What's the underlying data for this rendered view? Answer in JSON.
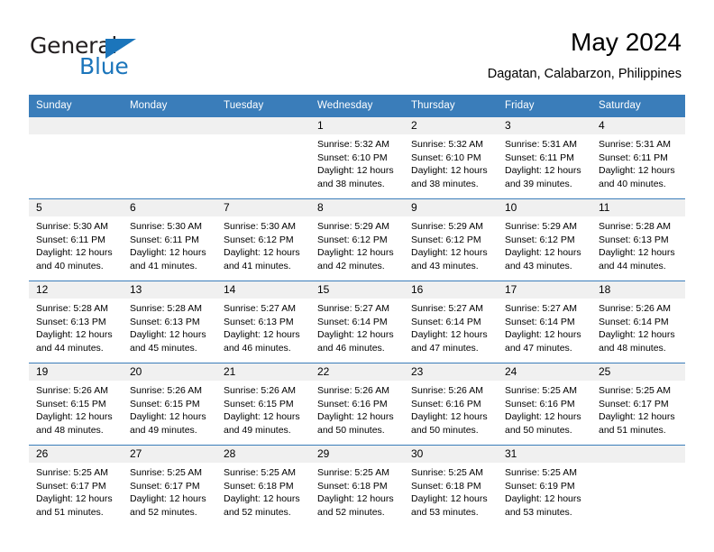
{
  "brand": {
    "name_part1": "General",
    "name_part2": "Blue",
    "triangle_icon": "triangle-icon",
    "color_dark": "#231f20",
    "color_blue": "#1b75bb"
  },
  "header": {
    "title": "May 2024",
    "subtitle": "Dagatan, Calabarzon, Philippines"
  },
  "theme": {
    "header_row_bg": "#3a7dba",
    "daynum_band_bg": "#f0f0f0",
    "row_divider": "#3a7dba",
    "text": "#000000"
  },
  "weekdays": [
    "Sunday",
    "Monday",
    "Tuesday",
    "Wednesday",
    "Thursday",
    "Friday",
    "Saturday"
  ],
  "labels": {
    "sunrise_prefix": "Sunrise:",
    "sunset_prefix": "Sunset:",
    "daylight_prefix": "Daylight:"
  },
  "weeks": [
    [
      {
        "day": "",
        "line1": "",
        "line2": "",
        "line3": "",
        "line4": "",
        "empty": true
      },
      {
        "day": "",
        "line1": "",
        "line2": "",
        "line3": "",
        "line4": "",
        "empty": true
      },
      {
        "day": "",
        "line1": "",
        "line2": "",
        "line3": "",
        "line4": "",
        "empty": true
      },
      {
        "day": "1",
        "line1": "Sunrise: 5:32 AM",
        "line2": "Sunset: 6:10 PM",
        "line3": "Daylight: 12 hours",
        "line4": "and 38 minutes.",
        "empty": false
      },
      {
        "day": "2",
        "line1": "Sunrise: 5:32 AM",
        "line2": "Sunset: 6:10 PM",
        "line3": "Daylight: 12 hours",
        "line4": "and 38 minutes.",
        "empty": false
      },
      {
        "day": "3",
        "line1": "Sunrise: 5:31 AM",
        "line2": "Sunset: 6:11 PM",
        "line3": "Daylight: 12 hours",
        "line4": "and 39 minutes.",
        "empty": false
      },
      {
        "day": "4",
        "line1": "Sunrise: 5:31 AM",
        "line2": "Sunset: 6:11 PM",
        "line3": "Daylight: 12 hours",
        "line4": "and 40 minutes.",
        "empty": false
      }
    ],
    [
      {
        "day": "5",
        "line1": "Sunrise: 5:30 AM",
        "line2": "Sunset: 6:11 PM",
        "line3": "Daylight: 12 hours",
        "line4": "and 40 minutes.",
        "empty": false
      },
      {
        "day": "6",
        "line1": "Sunrise: 5:30 AM",
        "line2": "Sunset: 6:11 PM",
        "line3": "Daylight: 12 hours",
        "line4": "and 41 minutes.",
        "empty": false
      },
      {
        "day": "7",
        "line1": "Sunrise: 5:30 AM",
        "line2": "Sunset: 6:12 PM",
        "line3": "Daylight: 12 hours",
        "line4": "and 41 minutes.",
        "empty": false
      },
      {
        "day": "8",
        "line1": "Sunrise: 5:29 AM",
        "line2": "Sunset: 6:12 PM",
        "line3": "Daylight: 12 hours",
        "line4": "and 42 minutes.",
        "empty": false
      },
      {
        "day": "9",
        "line1": "Sunrise: 5:29 AM",
        "line2": "Sunset: 6:12 PM",
        "line3": "Daylight: 12 hours",
        "line4": "and 43 minutes.",
        "empty": false
      },
      {
        "day": "10",
        "line1": "Sunrise: 5:29 AM",
        "line2": "Sunset: 6:12 PM",
        "line3": "Daylight: 12 hours",
        "line4": "and 43 minutes.",
        "empty": false
      },
      {
        "day": "11",
        "line1": "Sunrise: 5:28 AM",
        "line2": "Sunset: 6:13 PM",
        "line3": "Daylight: 12 hours",
        "line4": "and 44 minutes.",
        "empty": false
      }
    ],
    [
      {
        "day": "12",
        "line1": "Sunrise: 5:28 AM",
        "line2": "Sunset: 6:13 PM",
        "line3": "Daylight: 12 hours",
        "line4": "and 44 minutes.",
        "empty": false
      },
      {
        "day": "13",
        "line1": "Sunrise: 5:28 AM",
        "line2": "Sunset: 6:13 PM",
        "line3": "Daylight: 12 hours",
        "line4": "and 45 minutes.",
        "empty": false
      },
      {
        "day": "14",
        "line1": "Sunrise: 5:27 AM",
        "line2": "Sunset: 6:13 PM",
        "line3": "Daylight: 12 hours",
        "line4": "and 46 minutes.",
        "empty": false
      },
      {
        "day": "15",
        "line1": "Sunrise: 5:27 AM",
        "line2": "Sunset: 6:14 PM",
        "line3": "Daylight: 12 hours",
        "line4": "and 46 minutes.",
        "empty": false
      },
      {
        "day": "16",
        "line1": "Sunrise: 5:27 AM",
        "line2": "Sunset: 6:14 PM",
        "line3": "Daylight: 12 hours",
        "line4": "and 47 minutes.",
        "empty": false
      },
      {
        "day": "17",
        "line1": "Sunrise: 5:27 AM",
        "line2": "Sunset: 6:14 PM",
        "line3": "Daylight: 12 hours",
        "line4": "and 47 minutes.",
        "empty": false
      },
      {
        "day": "18",
        "line1": "Sunrise: 5:26 AM",
        "line2": "Sunset: 6:14 PM",
        "line3": "Daylight: 12 hours",
        "line4": "and 48 minutes.",
        "empty": false
      }
    ],
    [
      {
        "day": "19",
        "line1": "Sunrise: 5:26 AM",
        "line2": "Sunset: 6:15 PM",
        "line3": "Daylight: 12 hours",
        "line4": "and 48 minutes.",
        "empty": false
      },
      {
        "day": "20",
        "line1": "Sunrise: 5:26 AM",
        "line2": "Sunset: 6:15 PM",
        "line3": "Daylight: 12 hours",
        "line4": "and 49 minutes.",
        "empty": false
      },
      {
        "day": "21",
        "line1": "Sunrise: 5:26 AM",
        "line2": "Sunset: 6:15 PM",
        "line3": "Daylight: 12 hours",
        "line4": "and 49 minutes.",
        "empty": false
      },
      {
        "day": "22",
        "line1": "Sunrise: 5:26 AM",
        "line2": "Sunset: 6:16 PM",
        "line3": "Daylight: 12 hours",
        "line4": "and 50 minutes.",
        "empty": false
      },
      {
        "day": "23",
        "line1": "Sunrise: 5:26 AM",
        "line2": "Sunset: 6:16 PM",
        "line3": "Daylight: 12 hours",
        "line4": "and 50 minutes.",
        "empty": false
      },
      {
        "day": "24",
        "line1": "Sunrise: 5:25 AM",
        "line2": "Sunset: 6:16 PM",
        "line3": "Daylight: 12 hours",
        "line4": "and 50 minutes.",
        "empty": false
      },
      {
        "day": "25",
        "line1": "Sunrise: 5:25 AM",
        "line2": "Sunset: 6:17 PM",
        "line3": "Daylight: 12 hours",
        "line4": "and 51 minutes.",
        "empty": false
      }
    ],
    [
      {
        "day": "26",
        "line1": "Sunrise: 5:25 AM",
        "line2": "Sunset: 6:17 PM",
        "line3": "Daylight: 12 hours",
        "line4": "and 51 minutes.",
        "empty": false
      },
      {
        "day": "27",
        "line1": "Sunrise: 5:25 AM",
        "line2": "Sunset: 6:17 PM",
        "line3": "Daylight: 12 hours",
        "line4": "and 52 minutes.",
        "empty": false
      },
      {
        "day": "28",
        "line1": "Sunrise: 5:25 AM",
        "line2": "Sunset: 6:18 PM",
        "line3": "Daylight: 12 hours",
        "line4": "and 52 minutes.",
        "empty": false
      },
      {
        "day": "29",
        "line1": "Sunrise: 5:25 AM",
        "line2": "Sunset: 6:18 PM",
        "line3": "Daylight: 12 hours",
        "line4": "and 52 minutes.",
        "empty": false
      },
      {
        "day": "30",
        "line1": "Sunrise: 5:25 AM",
        "line2": "Sunset: 6:18 PM",
        "line3": "Daylight: 12 hours",
        "line4": "and 53 minutes.",
        "empty": false
      },
      {
        "day": "31",
        "line1": "Sunrise: 5:25 AM",
        "line2": "Sunset: 6:19 PM",
        "line3": "Daylight: 12 hours",
        "line4": "and 53 minutes.",
        "empty": false
      },
      {
        "day": "",
        "line1": "",
        "line2": "",
        "line3": "",
        "line4": "",
        "empty": true
      }
    ]
  ]
}
